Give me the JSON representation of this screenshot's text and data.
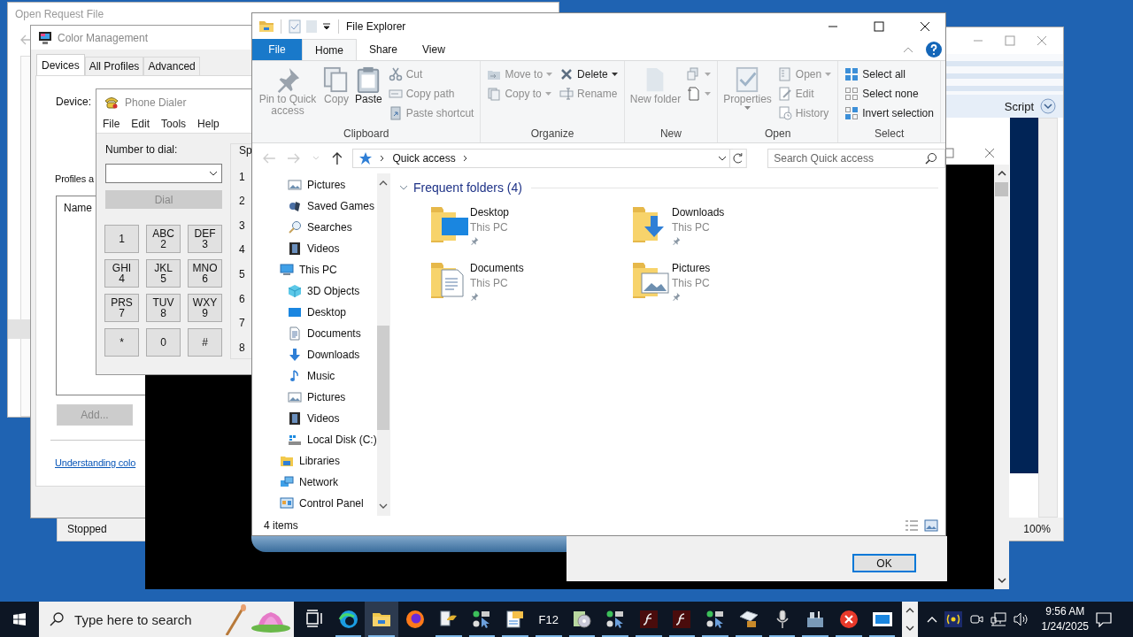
{
  "windows": {
    "open_request_file": {
      "title": "Open Request File"
    },
    "services": {
      "status": "Stopped"
    },
    "color_management": {
      "title": "Color Management",
      "tabs": [
        {
          "label": "Devices",
          "selected": true
        },
        {
          "label": "All Profiles",
          "selected": false
        },
        {
          "label": "Advanced",
          "selected": false
        }
      ],
      "device_label": "Device:",
      "profiles_label": "Profiles a",
      "list_header": "Name",
      "add_button": {
        "label": "Add...",
        "disabled": true
      },
      "link": "Understanding colo"
    },
    "editor": {
      "toolbar_label": "Script",
      "zoom": "100%"
    },
    "console_dialog": {
      "ok_button": "OK"
    },
    "phone_dialer": {
      "title": "Phone Dialer",
      "menu": [
        "File",
        "Edit",
        "Tools",
        "Help"
      ],
      "number_label": "Number to dial:",
      "dial_button": {
        "label": "Dial",
        "disabled": true
      },
      "keys": [
        {
          "digit": "1"
        },
        {
          "letters": "ABC",
          "digit": "2"
        },
        {
          "letters": "DEF",
          "digit": "3"
        },
        {
          "letters": "GHI",
          "digit": "4"
        },
        {
          "letters": "JKL",
          "digit": "5"
        },
        {
          "letters": "MNO",
          "digit": "6"
        },
        {
          "letters": "PRS",
          "digit": "7"
        },
        {
          "letters": "TUV",
          "digit": "8"
        },
        {
          "letters": "WXY",
          "digit": "9"
        },
        {
          "digit": "*"
        },
        {
          "digit": "0"
        },
        {
          "digit": "#"
        }
      ],
      "speed_dial_label": "Sp",
      "speed_dial_numbers": [
        "1",
        "2",
        "3",
        "4",
        "5",
        "6",
        "7",
        "8"
      ]
    }
  },
  "file_explorer": {
    "title": "File Explorer",
    "ribbon_tabs": [
      {
        "label": "File",
        "kind": "file",
        "selected": false
      },
      {
        "label": "Home",
        "kind": "tab",
        "selected": true
      },
      {
        "label": "Share",
        "kind": "tab",
        "selected": false
      },
      {
        "label": "View",
        "kind": "tab",
        "selected": false
      }
    ],
    "ribbon_groups": [
      {
        "label": "Clipboard",
        "columns": [
          {
            "kind": "large",
            "buttons": [
              {
                "kind": "pin",
                "label": "Pin to Quick access",
                "disabled": true
              }
            ]
          },
          {
            "kind": "large",
            "buttons": [
              {
                "kind": "copy",
                "label": "Copy",
                "disabled": true
              }
            ]
          },
          {
            "kind": "large",
            "buttons": [
              {
                "kind": "paste",
                "label": "Paste",
                "disabled": false
              }
            ]
          },
          {
            "kind": "small",
            "buttons": [
              {
                "kind": "cut",
                "label": "Cut",
                "disabled": true
              },
              {
                "kind": "copypath",
                "label": "Copy path",
                "disabled": true
              },
              {
                "kind": "pasteshortcut",
                "label": "Paste shortcut",
                "disabled": true
              }
            ]
          }
        ]
      },
      {
        "label": "Organize",
        "columns": [
          {
            "kind": "small",
            "buttons": [
              {
                "kind": "moveto",
                "label": "Move to",
                "disabled": true,
                "dropdown": true
              },
              {
                "kind": "copyto",
                "label": "Copy to",
                "disabled": true,
                "dropdown": true
              }
            ]
          },
          {
            "kind": "small",
            "buttons": [
              {
                "kind": "delete",
                "label": "Delete",
                "disabled": false,
                "dropdown": true
              },
              {
                "kind": "rename",
                "label": "Rename",
                "disabled": true
              }
            ]
          }
        ]
      },
      {
        "label": "New",
        "columns": [
          {
            "kind": "large",
            "buttons": [
              {
                "kind": "newfolder",
                "label": "New folder",
                "disabled": true
              }
            ]
          },
          {
            "kind": "small",
            "buttons": [
              {
                "kind": "newitem",
                "disabled": true,
                "dropdown": true
              },
              {
                "kind": "easyaccess",
                "disabled": true,
                "dropdown": true
              }
            ]
          }
        ]
      },
      {
        "label": "Open",
        "columns": [
          {
            "kind": "large",
            "buttons": [
              {
                "kind": "properties",
                "label": "Properties",
                "disabled": true,
                "dropdown": true
              }
            ]
          },
          {
            "kind": "small",
            "buttons": [
              {
                "kind": "open",
                "label": "Open",
                "disabled": true,
                "dropdown": true
              },
              {
                "kind": "edit",
                "label": "Edit",
                "disabled": true
              },
              {
                "kind": "history",
                "label": "History",
                "disabled": true
              }
            ]
          }
        ]
      },
      {
        "label": "Select",
        "columns": [
          {
            "kind": "small",
            "buttons": [
              {
                "kind": "selectall",
                "label": "Select all",
                "disabled": false
              },
              {
                "kind": "selectnone",
                "label": "Select none",
                "disabled": false
              },
              {
                "kind": "invert",
                "label": "Invert selection",
                "disabled": false
              }
            ]
          }
        ]
      }
    ],
    "address": "Quick access",
    "search_placeholder": "Search Quick access",
    "nav_tree": [
      {
        "children": [
          {
            "label": "Pictures",
            "kind": "pictures"
          },
          {
            "label": "Saved Games",
            "kind": "games"
          },
          {
            "label": "Searches",
            "kind": "search"
          },
          {
            "label": "Videos",
            "kind": "videos"
          }
        ]
      },
      {
        "label": "This PC",
        "kind": "pc",
        "children": [
          {
            "label": "3D Objects",
            "kind": "objects3d"
          },
          {
            "label": "Desktop",
            "kind": "desktop"
          },
          {
            "label": "Documents",
            "kind": "documents"
          },
          {
            "label": "Downloads",
            "kind": "downloads"
          },
          {
            "label": "Music",
            "kind": "music"
          },
          {
            "label": "Pictures",
            "kind": "pictures"
          },
          {
            "label": "Videos",
            "kind": "videos"
          },
          {
            "label": "Local Disk (C:)",
            "kind": "disk"
          }
        ]
      },
      {
        "label": "Libraries",
        "kind": "libraries"
      },
      {
        "label": "Network",
        "kind": "network"
      },
      {
        "label": "Control Panel",
        "kind": "control"
      }
    ],
    "section": {
      "title": "Frequent folders (4)",
      "expanded": true
    },
    "folders": [
      {
        "name": "Desktop",
        "location": "This PC",
        "kind": "desktop",
        "pinned": true
      },
      {
        "name": "Downloads",
        "location": "This PC",
        "kind": "downloads",
        "pinned": true
      },
      {
        "name": "Documents",
        "location": "This PC",
        "kind": "documents",
        "pinned": true
      },
      {
        "name": "Pictures",
        "location": "This PC",
        "kind": "pictures",
        "pinned": true
      }
    ],
    "status": "4 items"
  },
  "taskbar": {
    "search_placeholder": "Type here to search",
    "apps": [
      {
        "kind": "taskview",
        "running": false,
        "active": false
      },
      {
        "kind": "edge",
        "running": true,
        "active": false
      },
      {
        "kind": "explorer",
        "running": true,
        "active": true
      },
      {
        "kind": "firefox",
        "running": false,
        "active": false
      },
      {
        "kind": "lamp",
        "running": true,
        "active": false
      },
      {
        "kind": "pointer",
        "running": true,
        "active": false
      },
      {
        "kind": "notes",
        "running": true,
        "active": false
      },
      {
        "kind": "text",
        "text": "F12",
        "running": true,
        "active": false
      },
      {
        "kind": "disc",
        "running": true,
        "active": false
      },
      {
        "kind": "pointer",
        "running": true,
        "active": false
      },
      {
        "kind": "flash",
        "running": true,
        "active": false
      },
      {
        "kind": "flash",
        "running": true,
        "active": false
      },
      {
        "kind": "pointer",
        "running": true,
        "active": false
      },
      {
        "kind": "box",
        "running": true,
        "active": false
      },
      {
        "kind": "mic",
        "running": true,
        "active": false
      },
      {
        "kind": "toolbox",
        "running": true,
        "active": false
      },
      {
        "kind": "error",
        "running": true,
        "active": false
      },
      {
        "kind": "window",
        "running": true,
        "active": false
      }
    ],
    "time": "9:56 AM",
    "date": "1/24/2025"
  }
}
